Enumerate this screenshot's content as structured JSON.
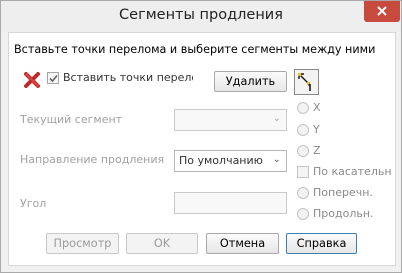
{
  "window": {
    "title": "Сегменты продления",
    "close_symbol": "x"
  },
  "instruction": "Вставьте точки перелома и выберите сегменты между ними",
  "insert_checkbox": {
    "label": "Вставить точки перелома",
    "checked": true
  },
  "delete_button": "Удалить",
  "icons": {
    "delete": "red-x-icon",
    "pick": "pick-point-icon",
    "close": "close-icon"
  },
  "current_segment": {
    "label": "Текущий сегмент",
    "value": ""
  },
  "direction": {
    "label": "Направление продления",
    "value": "По умолчанию"
  },
  "angle": {
    "label": "Угол",
    "value": ""
  },
  "options": {
    "x": "X",
    "y": "Y",
    "z": "Z",
    "tangent": "По касательн",
    "transverse": "Поперечн.",
    "longitudinal": "Продольн."
  },
  "buttons": {
    "preview": "Просмотр",
    "ok": "OK",
    "cancel": "Отмена",
    "help": "Справка"
  },
  "colors": {
    "close": "#c74a3f",
    "panel": "#ffffff",
    "accent": "#3c7fb1"
  }
}
